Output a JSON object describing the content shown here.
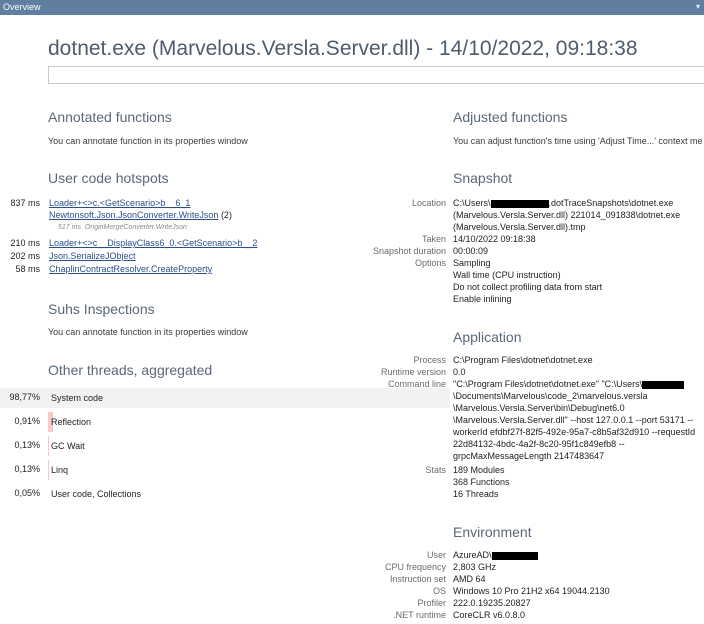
{
  "window": {
    "title": "Overview"
  },
  "header": {
    "title": "dotnet.exe (Marvelous.Versla.Server.dll) - 14/10/2022, 09:18:38"
  },
  "annotated": {
    "heading": "Annotated functions",
    "text": "You can annotate function in its properties window"
  },
  "adjusted": {
    "heading": "Adjusted functions",
    "text": "You can adjust function's time using 'Adjust Time...' context me"
  },
  "hotspots": {
    "heading": "User code hotspots",
    "items": [
      {
        "ms": "837 ms",
        "name": "Loader+<>c.<GetScenario>b__6_1"
      },
      {
        "ms": "",
        "name": "Newtonsoft.Json.JsonConverter.WriteJson",
        "extra": "(2)"
      },
      {
        "ms": "",
        "note_ms": "517 ms",
        "note": "OriginMergeConverter.WriteJson"
      },
      {
        "ms": "210 ms",
        "name": "Loader+<>c__DisplayClass6_0.<GetScenario>b__2"
      },
      {
        "ms": "202 ms",
        "name": "Json.SerializeJObject"
      },
      {
        "ms": "58 ms",
        "name": "ChaplinContractResolver.CreateProperty"
      }
    ]
  },
  "suhs": {
    "heading": "Suhs Inspections",
    "text": "You can annotate function in its properties window"
  },
  "threads": {
    "heading": "Other threads, aggregated",
    "rows": [
      {
        "pct": "98,77%",
        "label": "System code",
        "value": 98.77
      },
      {
        "pct": "0,91%",
        "label": "Reflection",
        "value": 0.91
      },
      {
        "pct": "0,13%",
        "label": "GC Wait",
        "value": 0.13
      },
      {
        "pct": "0,13%",
        "label": "Linq",
        "value": 0.13
      },
      {
        "pct": "0,05%",
        "label": "User code, Collections",
        "value": 0.05
      }
    ]
  },
  "snapshot": {
    "heading": "Snapshot",
    "location_label": "Location",
    "location_1a": "C:\\Users\\",
    "location_1b": ".dotTraceSnapshots\\dotnet.exe",
    "location_2": "(Marvelous.Versla.Server.dll) 221014_091838\\dotnet.exe",
    "location_3": "(Marvelous.Versla.Server.dll).tmp",
    "taken_label": "Taken",
    "taken": "14/10/2022 09:18:38",
    "duration_label": "Snapshot duration",
    "duration": "00:00:09",
    "options_label": "Options",
    "options": [
      "Sampling",
      "Wall time (CPU instruction)",
      "Do not collect profiling data from start",
      "Enable inlining"
    ]
  },
  "application": {
    "heading": "Application",
    "process_label": "Process",
    "process": "C:\\Program Files\\dotnet\\dotnet.exe",
    "runtime_label": "Runtime version",
    "runtime": "0.0",
    "cmd_label": "Command line",
    "cmd_1": "\"C:\\Program Files\\dotnet\\dotnet.exe\"  \"C:\\Users\\",
    "cmd_2": "\\Documents\\Marvelous\\code_2\\marvelous.versla",
    "cmd_3": "\\Marvelous.Versla.Server\\bin\\Debug\\net6.0",
    "cmd_4": "\\Marvelous.Versla.Server.dll\" --host 127.0.0.1 --port 53171 --",
    "cmd_5": "workerId efdbf27f-82f5-492e-95a7-c8b5af32d910 --requestId",
    "cmd_6": "22d84132-4bdc-4a2f-8c20-95f1c849efb8 --",
    "cmd_7": "grpcMaxMessageLength 2147483647",
    "stats_label": "Stats",
    "stats": [
      "189 Modules",
      "368 Functions",
      "16 Threads"
    ]
  },
  "environment": {
    "heading": "Environment",
    "user_label": "User",
    "user": "AzureAD\\",
    "cpu_label": "CPU frequency",
    "cpu": "2,803 GHz",
    "iset_label": "Instruction set",
    "iset": "AMD 64",
    "os_label": "OS",
    "os": "Windows 10 Pro 21H2 x64 19044.2130",
    "profiler_label": "Profiler",
    "profiler": "222.0.19235.20827",
    "net_label": ".NET runtime",
    "net": "CoreCLR v6.0.8.0"
  }
}
